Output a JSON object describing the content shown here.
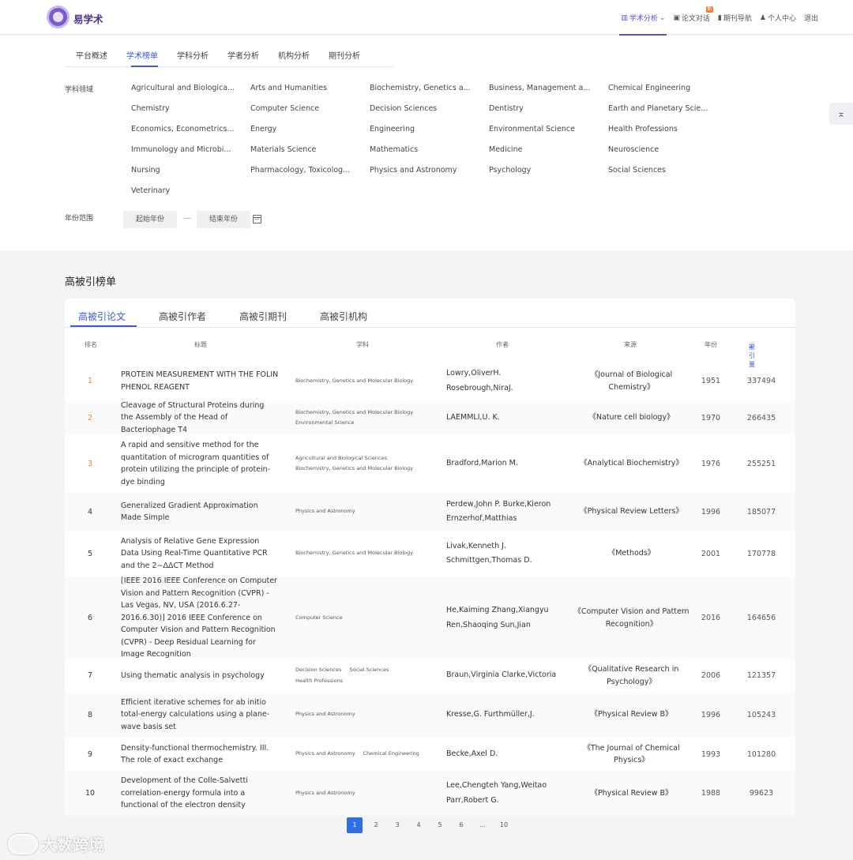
{
  "header": {
    "brand": "易学术",
    "nav": [
      {
        "label": "学术分析",
        "active": true,
        "icon": "chart-icon",
        "dropdown": true
      },
      {
        "label": "论文对话",
        "active": false,
        "icon": "chat-icon",
        "badge": "新"
      },
      {
        "label": "期刊导航",
        "active": false,
        "icon": "book-icon"
      },
      {
        "label": "个人中心",
        "active": false,
        "icon": "user-icon"
      },
      {
        "label": "退出",
        "active": false
      }
    ]
  },
  "subtabs": [
    "平台概述",
    "学术榜单",
    "学科分析",
    "学者分析",
    "机构分析",
    "期刊分析"
  ],
  "subtabs_active": 1,
  "filters": {
    "subject_label": "学科领域",
    "subjects": [
      "Agricultural and Biologica...",
      "Arts and Humanities",
      "Biochemistry, Genetics a...",
      "Business, Management a...",
      "Chemical Engineering",
      "Chemistry",
      "Computer Science",
      "Decision Sciences",
      "Dentistry",
      "Earth and Planetary Scie...",
      "Economics, Econometrics...",
      "Energy",
      "Engineering",
      "Environmental Science",
      "Health Professions",
      "Immunology and Microbi...",
      "Materials Science",
      "Mathematics",
      "Medicine",
      "Neuroscience",
      "Nursing",
      "Pharmacology, Toxicolog...",
      "Physics and Astronomy",
      "Psychology",
      "Social Sciences",
      "Veterinary"
    ],
    "year_label": "年份范围",
    "year_start_placeholder": "起始年份",
    "year_end_placeholder": "结束年份",
    "year_dash": "—"
  },
  "ranking": {
    "title": "高被引榜单",
    "tabs": [
      "高被引论文",
      "高被引作者",
      "高被引期刊",
      "高被引机构"
    ],
    "columns": [
      "排名",
      "标题",
      "学科",
      "作者",
      "来源",
      "年份",
      "被引量"
    ],
    "rows": [
      {
        "rank": "1",
        "title": "PROTEIN MEASUREMENT WITH THE FOLIN PHENOL REAGENT",
        "subjects": [
          "Biochemistry, Genetics and Molecular Biology"
        ],
        "authors": "Lowry,OliverH. Rosebrough,NiraJ.",
        "source": "《Journal of Biological Chemistry》",
        "year": "1951",
        "cited": "337494"
      },
      {
        "rank": "2",
        "title": "Cleavage of Structural Proteins during the Assembly of the Head of Bacteriophage T4",
        "subjects": [
          "Biochemistry, Genetics and Molecular Biology",
          "Environmental Science"
        ],
        "authors": "LAEMMLI,U. K.",
        "source": "《Nature cell biology》",
        "year": "1970",
        "cited": "266435"
      },
      {
        "rank": "3",
        "title": "A rapid and sensitive method for the quantitation of microgram quantities of protein utilizing the principle of protein-dye binding",
        "subjects": [
          "Agricultural and Biological Sciences",
          "Biochemistry, Genetics and Molecular Biology"
        ],
        "authors": "Bradford,Marion M.",
        "source": "《Analytical Biochemistry》",
        "year": "1976",
        "cited": "255251"
      },
      {
        "rank": "4",
        "title": "Generalized Gradient Approximation Made Simple",
        "subjects": [
          "Physics and Astronomy"
        ],
        "authors": "Perdew,John P.   Burke,Kieron Ernzerhof,Matthias",
        "source": "《Physical Review Letters》",
        "year": "1996",
        "cited": "185077"
      },
      {
        "rank": "5",
        "title": "Analysis of Relative Gene Expression Data Using Real-Time Quantitative PCR and the 2−ΔΔCT Method",
        "subjects": [
          "Biochemistry, Genetics and Molecular Biology"
        ],
        "authors": "Livak,Kenneth J. Schmittgen,Thomas D.",
        "source": "《Methods》",
        "year": "2001",
        "cited": "170778"
      },
      {
        "rank": "6",
        "title": "[IEEE 2016 IEEE Conference on Computer Vision and Pattern Recognition (CVPR) - Las Vegas, NV, USA (2016.6.27-2016.6.30)] 2016 IEEE Conference on Computer Vision and Pattern Recognition (CVPR) - Deep Residual Learning for Image Recognition",
        "subjects": [
          "Computer Science"
        ],
        "authors": "He,Kaiming   Zhang,Xiangyu Ren,Shaoqing   Sun,Jian",
        "source": "《Computer Vision and Pattern Recognition》",
        "year": "2016",
        "cited": "164656"
      },
      {
        "rank": "7",
        "title": "Using thematic analysis in psychology",
        "subjects": [
          "Decision Sciences",
          "Social Sciences",
          "Health Professions"
        ],
        "authors": "Braun,Virginia   Clarke,Victoria",
        "source": "《Qualitative Research in Psychology》",
        "year": "2006",
        "cited": "121357"
      },
      {
        "rank": "8",
        "title": "Efficient iterative schemes for ab initio total-energy calculations using a plane-wave basis set",
        "subjects": [
          "Physics and Astronomy"
        ],
        "authors": "Kresse,G.   Furthmüller,J.",
        "source": "《Physical Review B》",
        "year": "1996",
        "cited": "105243"
      },
      {
        "rank": "9",
        "title": "Density-functional thermochemistry. III. The role of exact exchange",
        "subjects": [
          "Physics and Astronomy",
          "Chemical Engineering"
        ],
        "authors": "Becke,Axel D.",
        "source": "《The Journal of Chemical Physics》",
        "year": "1993",
        "cited": "101280"
      },
      {
        "rank": "10",
        "title": "Development of the Colle-Salvetti correlation-energy formula into a functional of the electron density",
        "subjects": [
          "Physics and Astronomy"
        ],
        "authors": "Lee,Chengteh   Yang,Weitao Parr,Robert G.",
        "source": "《Physical Review B》",
        "year": "1988",
        "cited": "99623"
      }
    ]
  },
  "pagination": {
    "pages": [
      "1",
      "2",
      "3",
      "4",
      "5",
      "6",
      "...",
      "10"
    ],
    "active": "1"
  },
  "watermark": "大数跨境",
  "colors": {
    "accent": "#3a5bd9",
    "nav_active": "#5a4dcf",
    "rank_top": "#e08a2e",
    "page_active": "#2f6fe6"
  }
}
